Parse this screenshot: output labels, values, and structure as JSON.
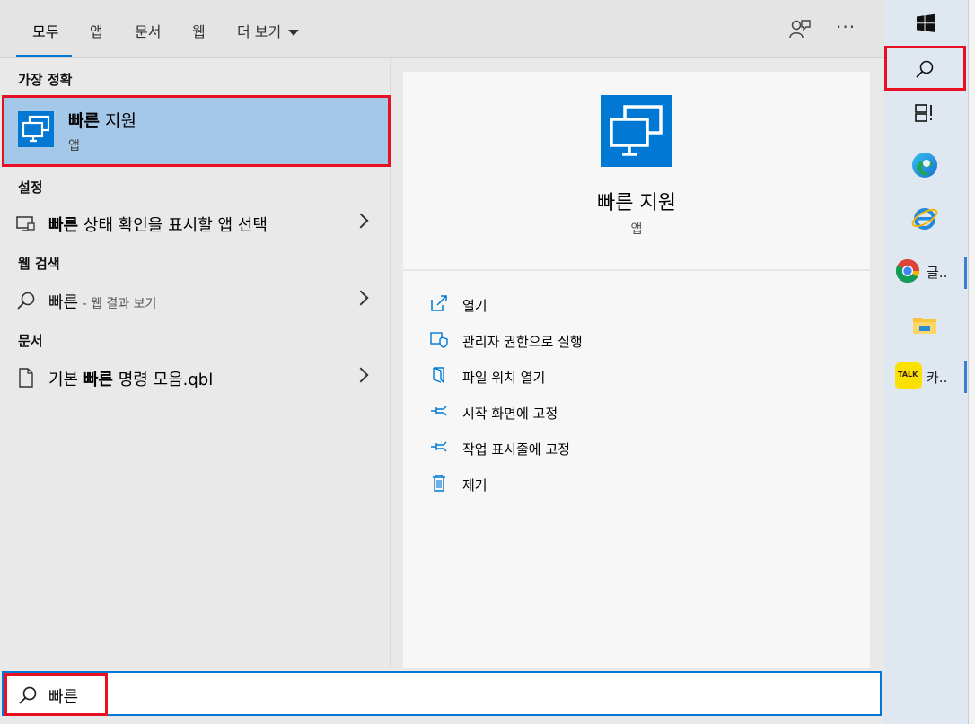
{
  "tabs": {
    "all": "모두",
    "apps": "앱",
    "documents": "문서",
    "web": "웹",
    "more": "더 보기",
    "feedback_icon": "feedback-icon",
    "more_icon": "···"
  },
  "results": {
    "best_match_header": "가장 정확",
    "best_match": {
      "title_bold": "빠른",
      "title_rest": " 지원",
      "subtitle": "앱"
    },
    "settings_header": "설정",
    "settings_item": {
      "bold": "빠른",
      "rest": " 상태 확인을 표시할 앱 선택"
    },
    "web_header": "웹 검색",
    "web_item": {
      "term": "빠른",
      "suffix": " - 웹 결과 보기"
    },
    "documents_header": "문서",
    "document_item": {
      "prefix": "기본 ",
      "bold": "빠른",
      "rest": " 명령 모음.qbl"
    }
  },
  "details": {
    "title": "빠른 지원",
    "subtitle": "앱",
    "actions": [
      {
        "label": "열기",
        "icon": "open-icon"
      },
      {
        "label": "관리자 권한으로 실행",
        "icon": "shield-icon"
      },
      {
        "label": "파일 위치 열기",
        "icon": "file-location-icon"
      },
      {
        "label": "시작 화면에 고정",
        "icon": "pin-icon"
      },
      {
        "label": "작업 표시줄에 고정",
        "icon": "pin-icon"
      },
      {
        "label": "제거",
        "icon": "trash-icon"
      }
    ]
  },
  "search": {
    "value": "빠른"
  },
  "taskbar": {
    "chrome_label": "글..",
    "kakao_label": "카..",
    "kakao_badge": "TALK"
  },
  "colors": {
    "accent": "#0078d4",
    "highlight": "#a4c8e8",
    "annotation": "#e81123"
  }
}
